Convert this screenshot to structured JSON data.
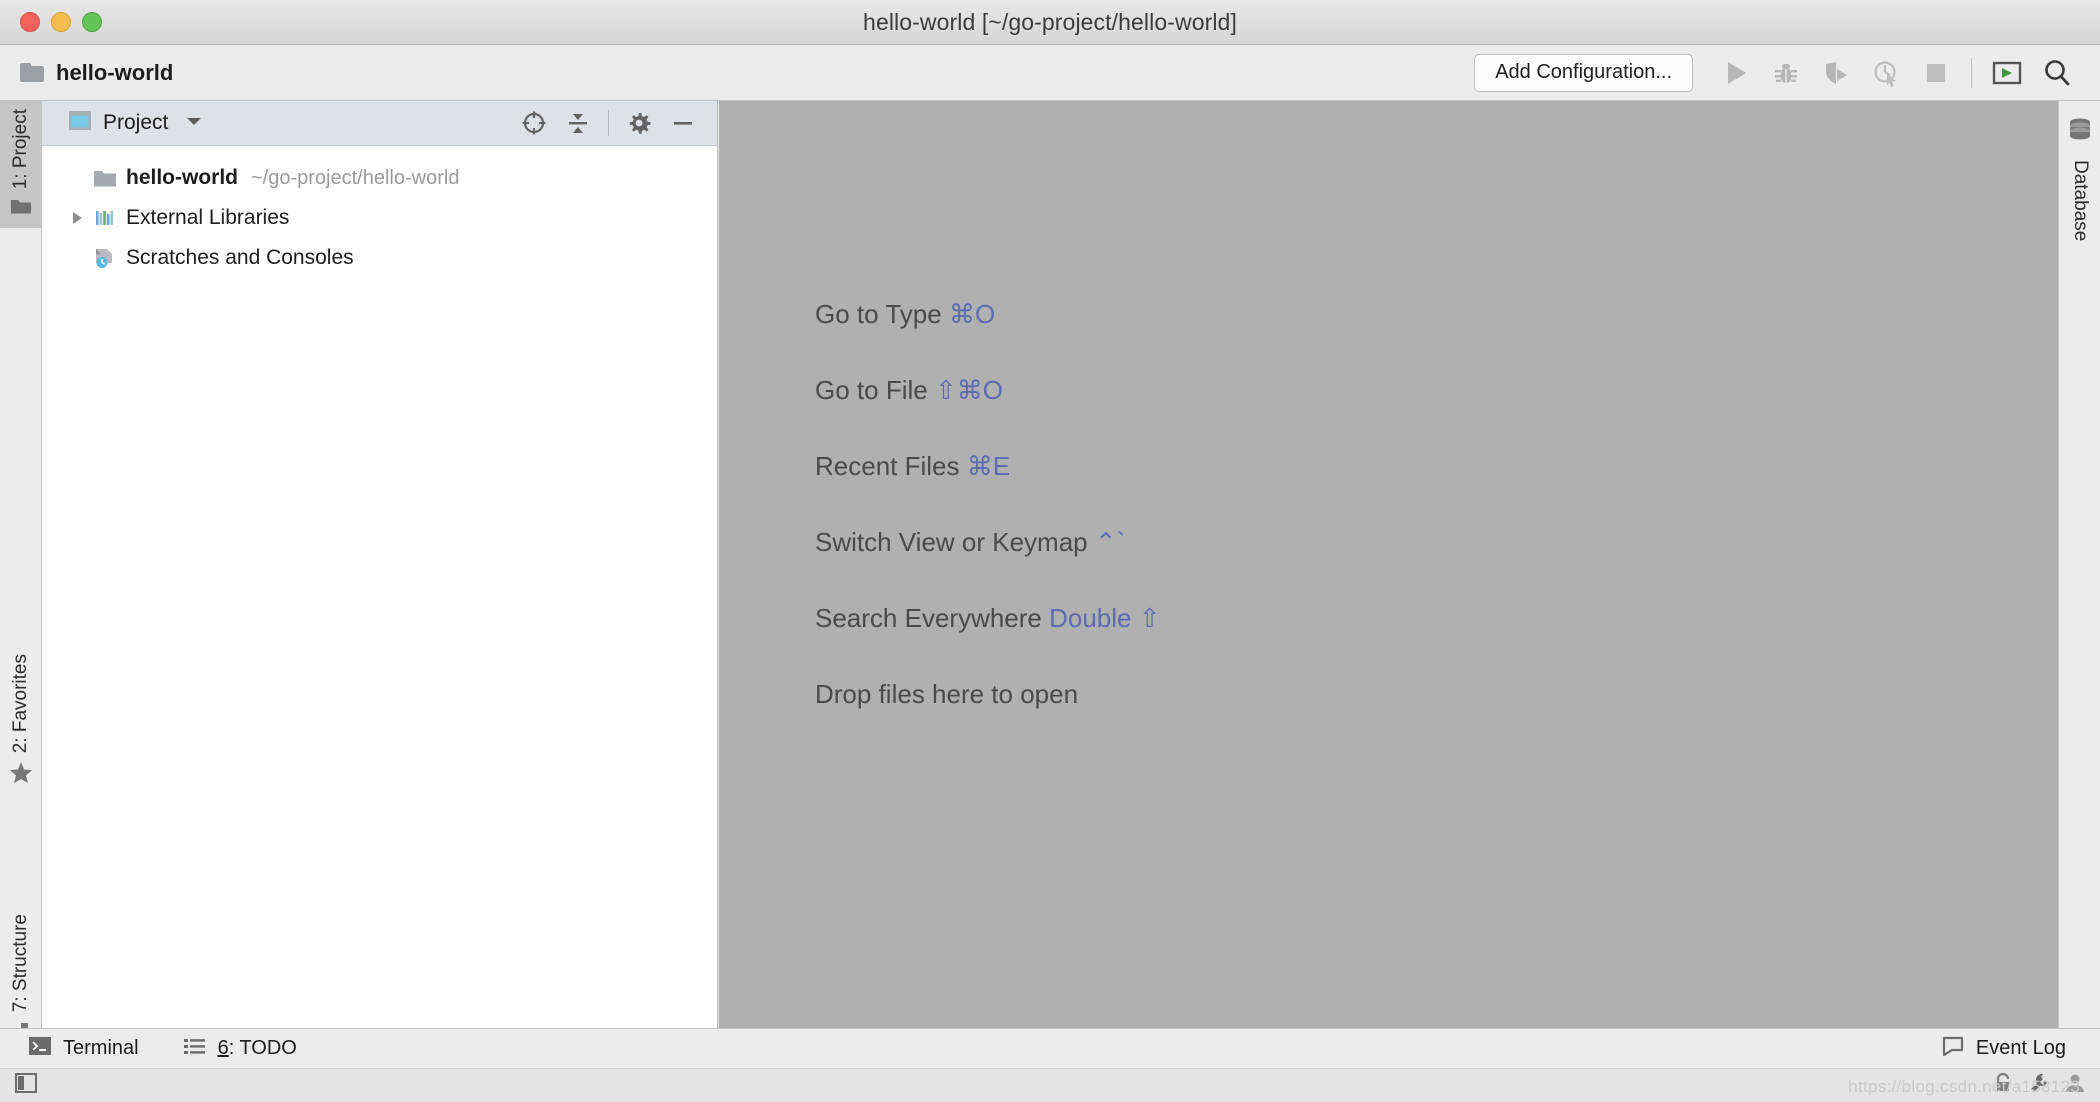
{
  "window": {
    "title": "hello-world [~/go-project/hello-world]"
  },
  "toolbar": {
    "project_name": "hello-world",
    "add_configuration_label": "Add Configuration...",
    "icons": [
      {
        "name": "run-icon",
        "title": "Run"
      },
      {
        "name": "debug-icon",
        "title": "Debug"
      },
      {
        "name": "run-with-coverage-icon",
        "title": "Run with Coverage"
      },
      {
        "name": "profile-icon",
        "title": "Profile"
      },
      {
        "name": "stop-icon",
        "title": "Stop"
      },
      {
        "name": "terminal-toggle-icon",
        "title": "Open Terminal"
      },
      {
        "name": "search-everywhere-icon",
        "title": "Search Everywhere"
      }
    ]
  },
  "left_rail": {
    "tabs": [
      {
        "label": "1: Project",
        "icon": "folder-icon",
        "active": true
      },
      {
        "label": "2: Favorites",
        "icon": "star-icon",
        "active": false
      },
      {
        "label": "7: Structure",
        "icon": "structure-icon",
        "active": false
      }
    ]
  },
  "right_rail": {
    "tabs": [
      {
        "label": "Database",
        "icon": "database-icon",
        "active": false
      }
    ]
  },
  "project_panel": {
    "title": "Project",
    "view_icon": "project-view-icon",
    "dropdown_icon": "chevron-down-icon",
    "actions": [
      {
        "name": "locate-icon",
        "title": "Select Opened File"
      },
      {
        "name": "collapse-all-icon",
        "title": "Collapse All"
      },
      {
        "name": "settings-gear-icon",
        "title": "Settings"
      },
      {
        "name": "hide-panel-icon",
        "title": "Hide"
      }
    ],
    "tree": [
      {
        "label": "hello-world",
        "sub": "~/go-project/hello-world",
        "icon": "folder-icon",
        "bold": true,
        "arrow": "none",
        "indent": 0
      },
      {
        "label": "External Libraries",
        "sub": "",
        "icon": "libraries-icon",
        "bold": false,
        "arrow": "collapsed",
        "indent": 0
      },
      {
        "label": "Scratches and Consoles",
        "sub": "",
        "icon": "scratches-icon",
        "bold": false,
        "arrow": "none",
        "indent": 0
      }
    ]
  },
  "editor": {
    "hints": [
      {
        "text": "Go to Type ",
        "key": "⌘O"
      },
      {
        "text": "Go to File ",
        "key": "⇧⌘O"
      },
      {
        "text": "Recent Files ",
        "key": "⌘E"
      },
      {
        "text": "Switch View or Keymap ",
        "key": "⌃`"
      },
      {
        "text": "Search Everywhere ",
        "key": "Double ⇧"
      },
      {
        "text": "Drop files here to open",
        "key": ""
      }
    ]
  },
  "statusbar": {
    "terminal_label": "Terminal",
    "todo_number": "6",
    "todo_label": ": TODO",
    "event_log_label": "Event Log"
  },
  "bottombar": {
    "watermark": "https://blog.csdn.net/a158123",
    "icons": [
      {
        "name": "lock-icon"
      },
      {
        "name": "wrench-icon"
      },
      {
        "name": "person-icon"
      },
      {
        "name": "layout-toggle-icon"
      }
    ]
  },
  "colors": {
    "accent_blue": "#5b6cb0",
    "editor_bg": "#b0b0b0",
    "panel_header": "#dde1e8"
  }
}
